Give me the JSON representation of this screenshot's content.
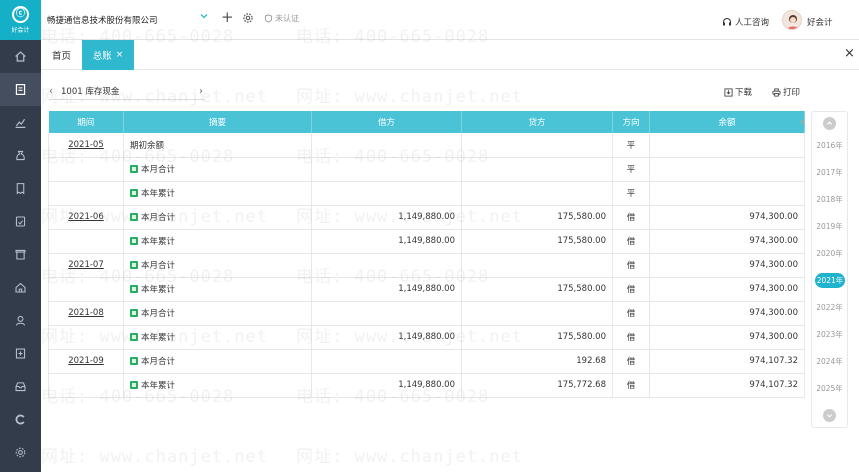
{
  "app": {
    "logo_glyph": "ⓒ",
    "logo_text": "好会计"
  },
  "header": {
    "company": "畅捷通信息技术股份有限公司",
    "certification": "未认证",
    "consult": "人工咨询",
    "user": "好会计"
  },
  "tabs": {
    "home": "首页",
    "active": "总账",
    "close_glyph": "×"
  },
  "panel_close_glyph": "×",
  "account": {
    "prev_glyph": "‹",
    "name": "1001 库存现金",
    "next_glyph": "›"
  },
  "actions": {
    "download": "下载",
    "print": "打印"
  },
  "table": {
    "headers": [
      "期间",
      "摘要",
      "借方",
      "贷方",
      "方向",
      "余额"
    ],
    "rows": [
      {
        "period": "2021-05",
        "summary": "期初余额",
        "icon": false,
        "debit": "",
        "credit": "",
        "direction": "平",
        "balance": ""
      },
      {
        "period": "",
        "summary": "本月合计",
        "icon": true,
        "debit": "",
        "credit": "",
        "direction": "平",
        "balance": ""
      },
      {
        "period": "",
        "summary": "本年累计",
        "icon": true,
        "debit": "",
        "credit": "",
        "direction": "平",
        "balance": ""
      },
      {
        "period": "2021-06",
        "summary": "本月合计",
        "icon": true,
        "debit": "1,149,880.00",
        "credit": "175,580.00",
        "direction": "借",
        "balance": "974,300.00"
      },
      {
        "period": "",
        "summary": "本年累计",
        "icon": true,
        "debit": "1,149,880.00",
        "credit": "175,580.00",
        "direction": "借",
        "balance": "974,300.00"
      },
      {
        "period": "2021-07",
        "summary": "本月合计",
        "icon": true,
        "debit": "",
        "credit": "",
        "direction": "借",
        "balance": "974,300.00"
      },
      {
        "period": "",
        "summary": "本年累计",
        "icon": true,
        "debit": "1,149,880.00",
        "credit": "175,580.00",
        "direction": "借",
        "balance": "974,300.00"
      },
      {
        "period": "2021-08",
        "summary": "本月合计",
        "icon": true,
        "debit": "",
        "credit": "",
        "direction": "借",
        "balance": "974,300.00"
      },
      {
        "period": "",
        "summary": "本年累计",
        "icon": true,
        "debit": "1,149,880.00",
        "credit": "175,580.00",
        "direction": "借",
        "balance": "974,300.00"
      },
      {
        "period": "2021-09",
        "summary": "本月合计",
        "icon": true,
        "debit": "",
        "credit": "192.68",
        "direction": "借",
        "balance": "974,107.32"
      },
      {
        "period": "",
        "summary": "本年累计",
        "icon": true,
        "debit": "1,149,880.00",
        "credit": "175,772.68",
        "direction": "借",
        "balance": "974,107.32"
      }
    ]
  },
  "years": {
    "items": [
      "2016年",
      "2017年",
      "2018年",
      "2019年",
      "2020年",
      "2021年",
      "2022年",
      "2023年",
      "2024年",
      "2025年"
    ],
    "selected": "2021年"
  },
  "watermark": {
    "phone": "电话: 400-665-0028",
    "site": "网址: www.chanjet.net"
  },
  "colors": {
    "sidebar": "#333c4b",
    "accent": "#2fb8ce",
    "table_header": "#4bc3d6"
  }
}
